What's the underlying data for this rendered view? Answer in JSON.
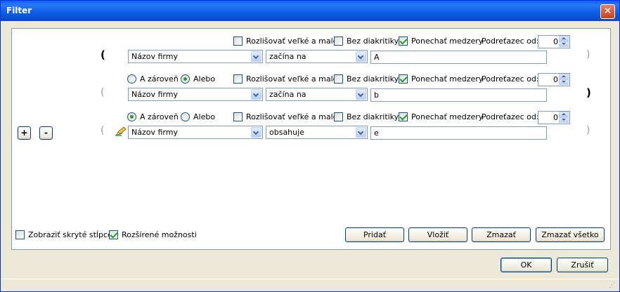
{
  "window": {
    "title": "Filter",
    "close_symbol": "✕"
  },
  "options": {
    "case": "Rozlišovať veľké a malé",
    "diacritics": "Bez diakritiky",
    "spaces": "Ponechať medzery",
    "substring": "Podreťazec od:"
  },
  "logic": {
    "and": "A zároveň",
    "or": "Alebo"
  },
  "rows": [
    {
      "open_paren": "(",
      "close_paren": ")",
      "field": "Názov firmy",
      "operator": "začína na",
      "value": "A",
      "spin": "0",
      "case_checked": false,
      "diacritics_checked": false,
      "spaces_checked": true
    },
    {
      "open_paren": "(",
      "close_paren": ")",
      "field": "Názov firmy",
      "operator": "začína na",
      "value": "b",
      "spin": "0",
      "logic": "or",
      "case_checked": false,
      "diacritics_checked": false,
      "spaces_checked": true
    },
    {
      "open_paren": "(",
      "close_paren": ")",
      "field": "Názov firmy",
      "operator": "obsahuje",
      "value": "e",
      "spin": "0",
      "logic": "and",
      "case_checked": false,
      "diacritics_checked": false,
      "spaces_checked": true
    }
  ],
  "add_remove": {
    "plus": "+",
    "minus": "-"
  },
  "bottom": {
    "show_hidden": "Zobraziť skryté stĺpce",
    "extended": "Rozšírené možnosti",
    "add": "Pridať",
    "insert": "Vložiť",
    "delete": "Zmazať",
    "delete_all": "Zmazať všetko"
  },
  "footer": {
    "ok": "OK",
    "cancel": "Zrušiť"
  },
  "colors": {
    "title_bar": "#0a5ee6",
    "panel_border": "#7f9db9",
    "check_mark": "#21a121"
  }
}
